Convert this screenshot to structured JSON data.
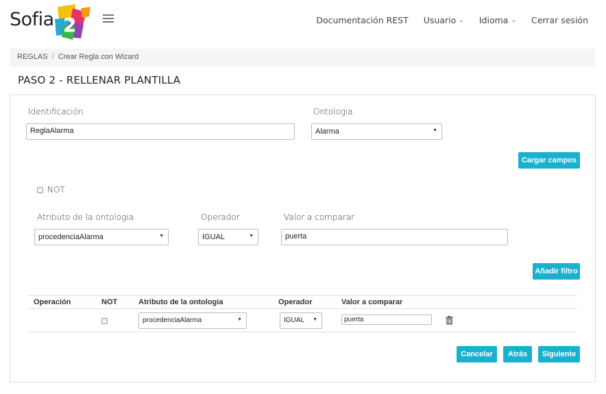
{
  "header": {
    "logo_text": "Sofia",
    "logo_badge": "2",
    "nav": {
      "docs": "Documentación REST",
      "user": "Usuario",
      "language": "Idioma",
      "logout": "Cerrar sesión"
    }
  },
  "breadcrumb": {
    "root": "REGLAS",
    "separator": "/",
    "current": "Crear Regla con Wizard"
  },
  "page_title": "PASO 2 - RELLENAR PLANTILLA",
  "form": {
    "identificacion_label": "Identificación",
    "identificacion_value": "ReglaAlarma",
    "ontologia_label": "Ontologia",
    "ontologia_value": "Alarma",
    "load_fields_button": "Cargar campos",
    "not_label": "NOT",
    "atributo_label": "Atributo de la ontologia",
    "atributo_value": "procedenciaAlarma",
    "operador_label": "Operador",
    "operador_value": "IGUAL",
    "valor_label": "Valor a comparar",
    "valor_value": "puerta",
    "add_filter_button": "Añadir filtro"
  },
  "table": {
    "headers": [
      "Operación",
      "NOT",
      "Atributo de la ontologia",
      "Operador",
      "Valor a comparar"
    ],
    "rows": [
      {
        "operacion": "",
        "atributo": "procedenciaAlarma",
        "operador": "IGUAL",
        "valor": "puerta"
      }
    ]
  },
  "actions": {
    "cancel": "Cancelar",
    "back": "Atrás",
    "next": "Siguiente"
  },
  "colors": {
    "accent": "#1ab1cf",
    "breadcrumb_bg": "#f5f5f5"
  }
}
